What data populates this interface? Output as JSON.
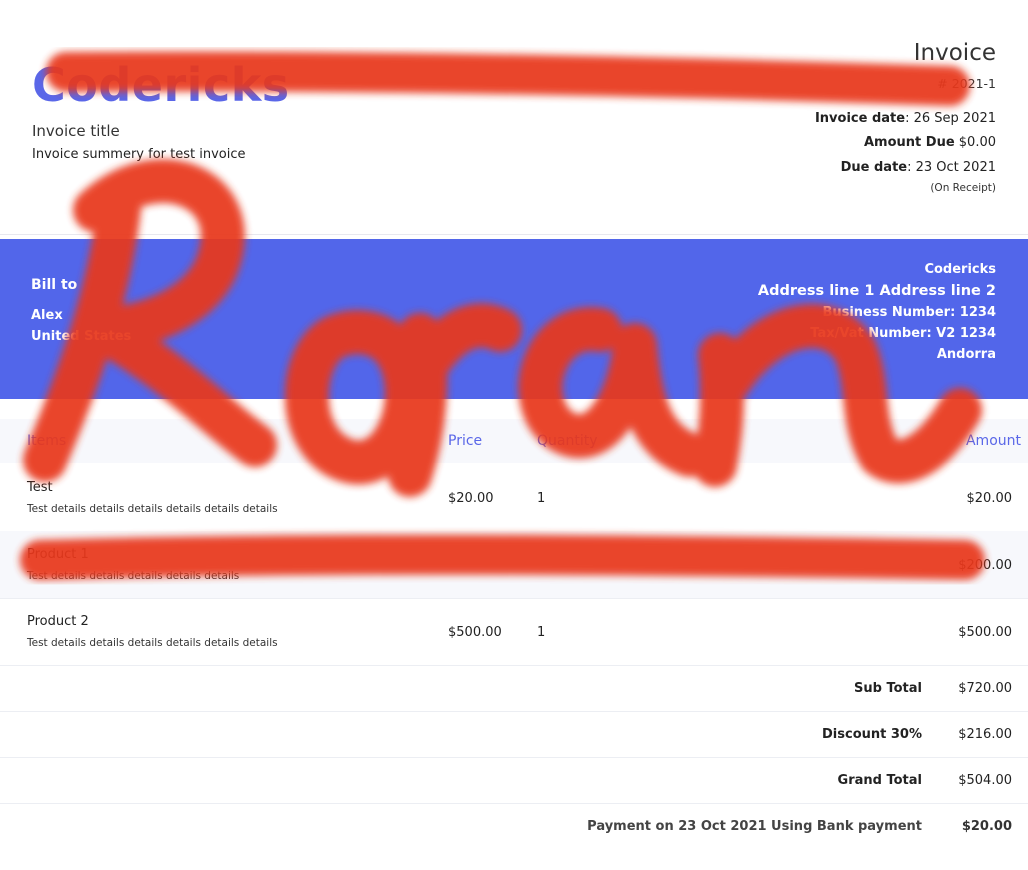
{
  "header": {
    "brand": "Codericks",
    "invoice_title": "Invoice title",
    "invoice_summary": "Invoice summery for test invoice",
    "doc_heading": "Invoice",
    "doc_number": "# 2021-1",
    "invoice_date_label": "Invoice date",
    "invoice_date_value": ": 26 Sep 2021",
    "amount_due_label": "Amount Due",
    "amount_due_value": " $0.00",
    "due_date_label": "Due date",
    "due_date_value": ": 23 Oct 2021",
    "receipt_note": "(On Receipt)"
  },
  "billing": {
    "bill_to_label": "Bill to",
    "bill_to_name": "Alex",
    "bill_to_country": "United States",
    "from_lines": [
      "Codericks",
      "Address line 1 Address line 2",
      "Business Number: 1234",
      "Tax/Vat Number: V2 1234",
      "Andorra"
    ]
  },
  "table": {
    "headers": {
      "items": "Items",
      "price": "Price",
      "quantity": "Quantity",
      "amount": "Amount"
    },
    "rows": [
      {
        "name": "Test",
        "details": "Test details details details details details details",
        "price": "$20.00",
        "qty": "1",
        "amount": "$20.00"
      },
      {
        "name": "Product 1",
        "details": "Test details details details details details",
        "price": "",
        "qty": "",
        "amount": "$200.00"
      },
      {
        "name": "Product 2",
        "details": "Test details details details details details details",
        "price": "$500.00",
        "qty": "1",
        "amount": "$500.00"
      }
    ]
  },
  "totals": [
    {
      "label": "Sub Total",
      "value": "$720.00"
    },
    {
      "label": "Discount 30%",
      "value": "$216.00"
    },
    {
      "label": "Grand Total",
      "value": "$504.00"
    },
    {
      "label": "Payment on 23 Oct 2021 Using Bank payment",
      "value": "$20.00"
    }
  ],
  "overlay": {
    "text": "Ronan",
    "color": "#e8391b"
  },
  "colors": {
    "accent": "#5266ea",
    "brand": "#5a67e8",
    "row_alt": "#f7f8fc"
  }
}
